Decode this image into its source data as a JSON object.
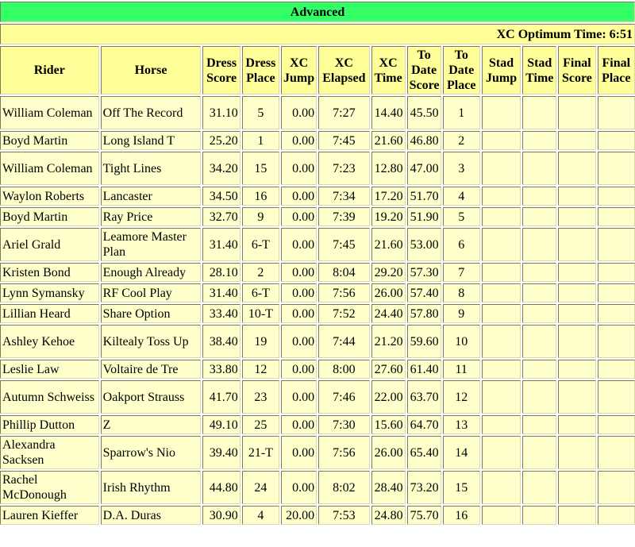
{
  "banner": "Advanced",
  "optimum": "XC Optimum Time: 6:51",
  "columns": [
    "Rider",
    "Horse",
    "Dress Score",
    "Dress Place",
    "XC Jump",
    "XC Elapsed",
    "XC Time",
    "To Date Score",
    "To Date Place",
    "Stad Jump",
    "Stad Time",
    "Final Score",
    "Final Place"
  ],
  "rows": [
    {
      "rider": "William Coleman",
      "horse": "Off The Record",
      "dress_score": "31.10",
      "dress_place": "5",
      "xc_jump": "0.00",
      "xc_elapsed": "7:27",
      "xc_time": "14.40",
      "to_date_score": "45.50",
      "to_date_place": "1",
      "tall": true
    },
    {
      "rider": "Boyd Martin",
      "horse": "Long Island T",
      "dress_score": "25.20",
      "dress_place": "1",
      "xc_jump": "0.00",
      "xc_elapsed": "7:45",
      "xc_time": "21.60",
      "to_date_score": "46.80",
      "to_date_place": "2",
      "tall": false
    },
    {
      "rider": "William Coleman",
      "horse": "Tight Lines",
      "dress_score": "34.20",
      "dress_place": "15",
      "xc_jump": "0.00",
      "xc_elapsed": "7:23",
      "xc_time": "12.80",
      "to_date_score": "47.00",
      "to_date_place": "3",
      "tall": true
    },
    {
      "rider": "Waylon Roberts",
      "horse": "Lancaster",
      "dress_score": "34.50",
      "dress_place": "16",
      "xc_jump": "0.00",
      "xc_elapsed": "7:34",
      "xc_time": "17.20",
      "to_date_score": "51.70",
      "to_date_place": "4",
      "tall": false
    },
    {
      "rider": "Boyd Martin",
      "horse": "Ray Price",
      "dress_score": "32.70",
      "dress_place": "9",
      "xc_jump": "0.00",
      "xc_elapsed": "7:39",
      "xc_time": "19.20",
      "to_date_score": "51.90",
      "to_date_place": "5",
      "tall": false
    },
    {
      "rider": "Ariel Grald",
      "horse": "Leamore Master Plan",
      "dress_score": "31.40",
      "dress_place": "6-T",
      "xc_jump": "0.00",
      "xc_elapsed": "7:45",
      "xc_time": "21.60",
      "to_date_score": "53.00",
      "to_date_place": "6",
      "tall": true
    },
    {
      "rider": "Kristen Bond",
      "horse": "Enough Already",
      "dress_score": "28.10",
      "dress_place": "2",
      "xc_jump": "0.00",
      "xc_elapsed": "8:04",
      "xc_time": "29.20",
      "to_date_score": "57.30",
      "to_date_place": "7",
      "tall": false
    },
    {
      "rider": "Lynn Symansky",
      "horse": "RF Cool Play",
      "dress_score": "31.40",
      "dress_place": "6-T",
      "xc_jump": "0.00",
      "xc_elapsed": "7:56",
      "xc_time": "26.00",
      "to_date_score": "57.40",
      "to_date_place": "8",
      "tall": false
    },
    {
      "rider": "Lillian Heard",
      "horse": "Share Option",
      "dress_score": "33.40",
      "dress_place": "10-T",
      "xc_jump": "0.00",
      "xc_elapsed": "7:52",
      "xc_time": "24.40",
      "to_date_score": "57.80",
      "to_date_place": "9",
      "tall": false
    },
    {
      "rider": "Ashley Kehoe",
      "horse": "Kiltealy Toss Up",
      "dress_score": "38.40",
      "dress_place": "19",
      "xc_jump": "0.00",
      "xc_elapsed": "7:44",
      "xc_time": "21.20",
      "to_date_score": "59.60",
      "to_date_place": "10",
      "tall": true
    },
    {
      "rider": "Leslie Law",
      "horse": "Voltaire de Tre",
      "dress_score": "33.80",
      "dress_place": "12",
      "xc_jump": "0.00",
      "xc_elapsed": "8:00",
      "xc_time": "27.60",
      "to_date_score": "61.40",
      "to_date_place": "11",
      "tall": false
    },
    {
      "rider": "Autumn Schweiss",
      "horse": "Oakport Strauss",
      "dress_score": "41.70",
      "dress_place": "23",
      "xc_jump": "0.00",
      "xc_elapsed": "7:46",
      "xc_time": "22.00",
      "to_date_score": "63.70",
      "to_date_place": "12",
      "tall": true
    },
    {
      "rider": "Phillip Dutton",
      "horse": "Z",
      "dress_score": "49.10",
      "dress_place": "25",
      "xc_jump": "0.00",
      "xc_elapsed": "7:30",
      "xc_time": "15.60",
      "to_date_score": "64.70",
      "to_date_place": "13",
      "tall": false
    },
    {
      "rider": "Alexandra Sacksen",
      "horse": "Sparrow's Nio",
      "dress_score": "39.40",
      "dress_place": "21-T",
      "xc_jump": "0.00",
      "xc_elapsed": "7:56",
      "xc_time": "26.00",
      "to_date_score": "65.40",
      "to_date_place": "14",
      "tall": true
    },
    {
      "rider": "Rachel McDonough",
      "horse": "Irish Rhythm",
      "dress_score": "44.80",
      "dress_place": "24",
      "xc_jump": "0.00",
      "xc_elapsed": "8:02",
      "xc_time": "28.40",
      "to_date_score": "73.20",
      "to_date_place": "15",
      "tall": true
    },
    {
      "rider": "Lauren Kieffer",
      "horse": "D.A. Duras",
      "dress_score": "30.90",
      "dress_place": "4",
      "xc_jump": "20.00",
      "xc_elapsed": "7:53",
      "xc_time": "24.80",
      "to_date_score": "75.70",
      "to_date_place": "16",
      "tall": false
    }
  ],
  "colors": {
    "banner_bg": "#33ff66",
    "header_bg": "#ffff99",
    "cell_bg": "#ffffcc"
  }
}
